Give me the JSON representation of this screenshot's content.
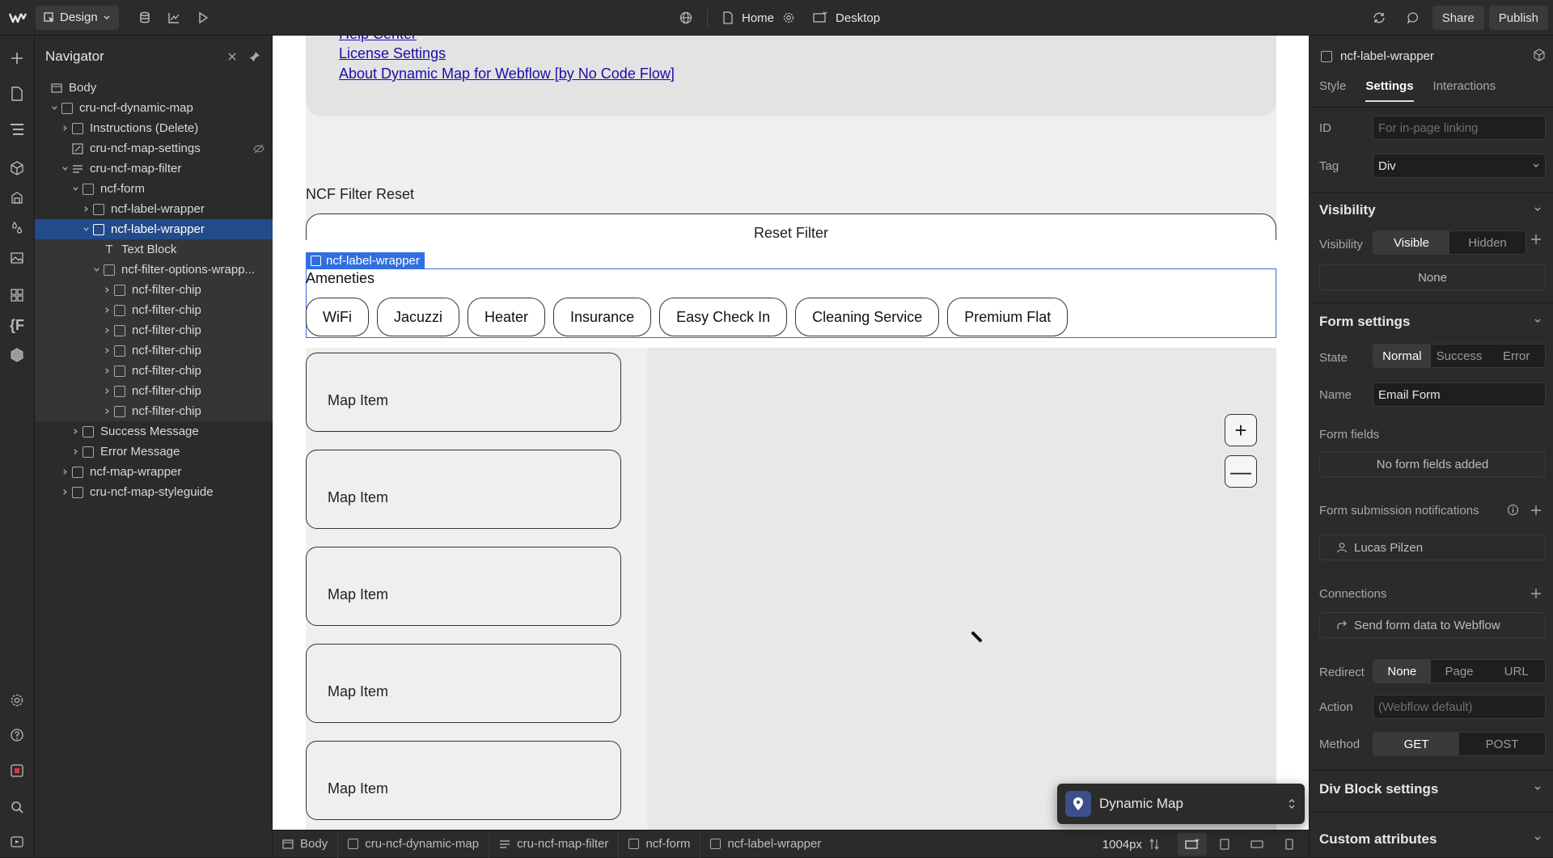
{
  "topbar": {
    "mode_label": "Design",
    "page_label": "Home",
    "breakpoint_label": "Desktop",
    "share_label": "Share",
    "publish_label": "Publish"
  },
  "navigator": {
    "title": "Navigator",
    "tree": [
      {
        "label": "Body",
        "indent": 0,
        "chevron": "",
        "icon": "body"
      },
      {
        "label": "cru-ncf-dynamic-map",
        "indent": 1,
        "chevron": "down",
        "icon": "box"
      },
      {
        "label": "Instructions (Delete)",
        "indent": 2,
        "chevron": "right",
        "icon": "box"
      },
      {
        "label": "cru-ncf-map-settings",
        "indent": 2,
        "chevron": "",
        "icon": "embed",
        "hidden": true
      },
      {
        "label": "cru-ncf-map-filter",
        "indent": 2,
        "chevron": "down",
        "icon": "form"
      },
      {
        "label": "ncf-form",
        "indent": 3,
        "chevron": "down",
        "icon": "box"
      },
      {
        "label": "ncf-label-wrapper",
        "indent": 4,
        "chevron": "right",
        "icon": "box"
      },
      {
        "label": "ncf-label-wrapper",
        "indent": 4,
        "chevron": "down",
        "icon": "box",
        "selected": true
      },
      {
        "label": "Text Block",
        "indent": 5,
        "chevron": "",
        "icon": "text",
        "child": true
      },
      {
        "label": "ncf-filter-options-wrapp...",
        "indent": 5,
        "chevron": "down",
        "icon": "box",
        "child": true
      },
      {
        "label": "ncf-filter-chip",
        "indent": 6,
        "chevron": "right",
        "icon": "box",
        "child": true
      },
      {
        "label": "ncf-filter-chip",
        "indent": 6,
        "chevron": "right",
        "icon": "box",
        "child": true
      },
      {
        "label": "ncf-filter-chip",
        "indent": 6,
        "chevron": "right",
        "icon": "box",
        "child": true
      },
      {
        "label": "ncf-filter-chip",
        "indent": 6,
        "chevron": "right",
        "icon": "box",
        "child": true
      },
      {
        "label": "ncf-filter-chip",
        "indent": 6,
        "chevron": "right",
        "icon": "box",
        "child": true
      },
      {
        "label": "ncf-filter-chip",
        "indent": 6,
        "chevron": "right",
        "icon": "box",
        "child": true
      },
      {
        "label": "ncf-filter-chip",
        "indent": 6,
        "chevron": "right",
        "icon": "box",
        "child": true
      },
      {
        "label": "Success Message",
        "indent": 3,
        "chevron": "right",
        "icon": "box"
      },
      {
        "label": "Error Message",
        "indent": 3,
        "chevron": "right",
        "icon": "box"
      },
      {
        "label": "ncf-map-wrapper",
        "indent": 2,
        "chevron": "right",
        "icon": "box"
      },
      {
        "label": "cru-ncf-map-styleguide",
        "indent": 2,
        "chevron": "right",
        "icon": "box"
      }
    ]
  },
  "canvas": {
    "links": [
      "Help Center",
      "License Settings",
      "About Dynamic Map for Webflow [by No Code Flow]"
    ],
    "reset_title": "NCF Filter Reset",
    "reset_button": "Reset Filter",
    "selection_label": "ncf-label-wrapper",
    "amenities_label": "Ameneties",
    "chips": [
      "WiFi",
      "Jacuzzi",
      "Heater",
      "Insurance",
      "Easy Check In",
      "Cleaning Service",
      "Premium Flat"
    ],
    "map_items": [
      "Map Item",
      "Map Item",
      "Map Item",
      "Map Item",
      "Map Item"
    ],
    "zoom_in": "+",
    "zoom_out": "—"
  },
  "breadcrumbs": {
    "items": [
      "Body",
      "cru-ncf-dynamic-map",
      "cru-ncf-map-filter",
      "ncf-form",
      "ncf-label-wrapper"
    ],
    "width_readout": "1004px"
  },
  "dynamic_map_panel": {
    "title": "Dynamic Map"
  },
  "right_panel": {
    "element_name": "ncf-label-wrapper",
    "tabs": [
      "Style",
      "Settings",
      "Interactions"
    ],
    "active_tab": "Settings",
    "id_label": "ID",
    "id_placeholder": "For in-page linking",
    "tag_label": "Tag",
    "tag_value": "Div",
    "visibility_heading": "Visibility",
    "visibility_label": "Visibility",
    "visibility_options": [
      "Visible",
      "Hidden"
    ],
    "visibility_none": "None",
    "form_settings_heading": "Form settings",
    "state_label": "State",
    "state_options": [
      "Normal",
      "Success",
      "Error"
    ],
    "name_label": "Name",
    "name_value": "Email Form",
    "form_fields_label": "Form fields",
    "no_fields": "No form fields added",
    "notifications_label": "Form submission notifications",
    "notification_user": "Lucas Pilzen",
    "connections_label": "Connections",
    "connection_item": "Send form data to Webflow",
    "redirect_label": "Redirect",
    "redirect_options": [
      "None",
      "Page",
      "URL"
    ],
    "action_label": "Action",
    "action_placeholder": "(Webflow default)",
    "method_label": "Method",
    "method_options": [
      "GET",
      "POST"
    ],
    "div_block_heading": "Div Block settings",
    "custom_attr_heading": "Custom attributes"
  }
}
